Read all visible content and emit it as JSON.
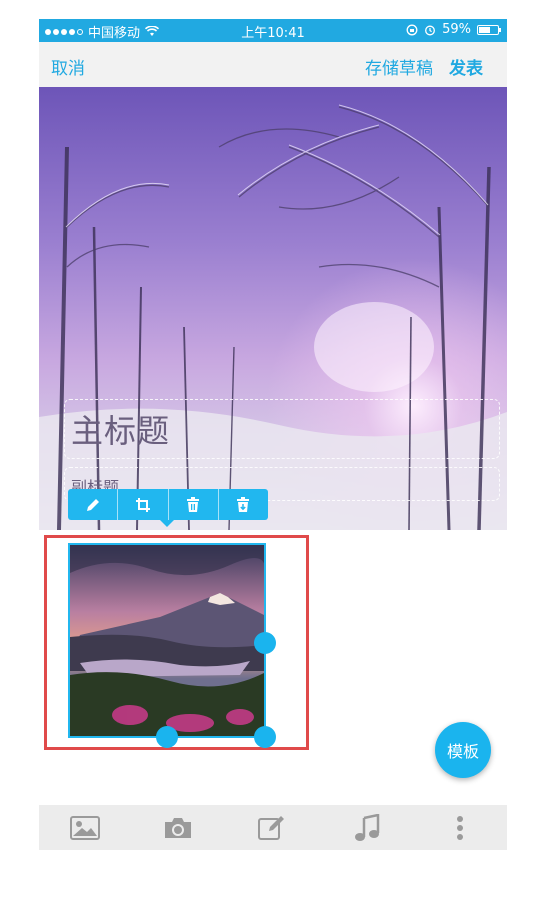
{
  "status_bar": {
    "carrier": "中国移动",
    "time": "上午10:41",
    "battery": "59%",
    "battery_level": 0.59
  },
  "nav": {
    "cancel": "取消",
    "save_draft": "存储草稿",
    "publish": "发表"
  },
  "cover": {
    "title": "主标题",
    "subtitle": "副标题"
  },
  "edit_toolbar": {
    "icons": [
      "pencil-icon",
      "crop-icon",
      "trash-icon",
      "download-icon"
    ]
  },
  "template_button": "模板",
  "bottom_bar": {
    "icons": [
      "image-icon",
      "camera-icon",
      "edit-icon",
      "music-icon",
      "more-icon"
    ]
  },
  "colors": {
    "accent": "#21a9e1",
    "selection": "#e04a4a"
  }
}
